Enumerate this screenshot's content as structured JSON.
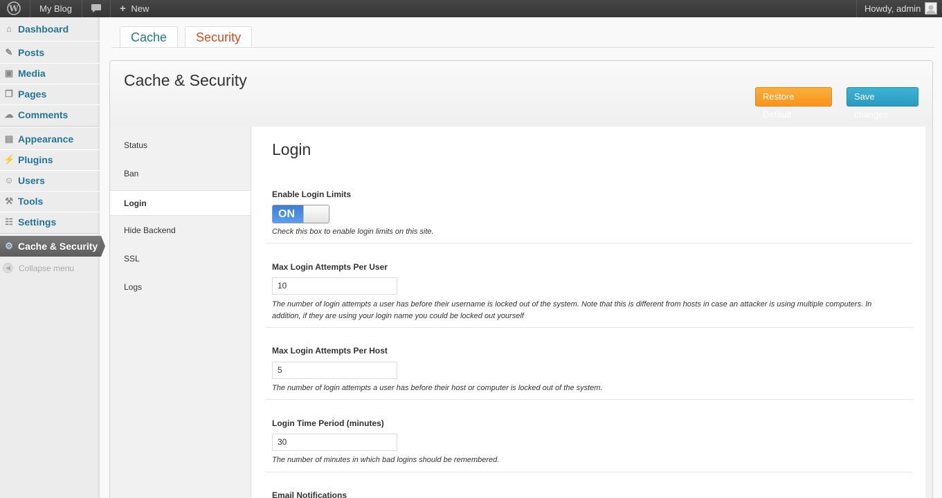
{
  "adminbar": {
    "site_name": "My Blog",
    "new_label": "New",
    "howdy": "Howdy, admin"
  },
  "sidebar": {
    "items": [
      {
        "label": "Dashboard",
        "icon": "dashboard-icon"
      },
      {
        "label": "Posts",
        "icon": "pin-icon"
      },
      {
        "label": "Media",
        "icon": "media-icon"
      },
      {
        "label": "Pages",
        "icon": "pages-icon"
      },
      {
        "label": "Comments",
        "icon": "comment-icon"
      },
      {
        "label": "Appearance",
        "icon": "appearance-icon"
      },
      {
        "label": "Plugins",
        "icon": "plug-icon"
      },
      {
        "label": "Users",
        "icon": "users-icon"
      },
      {
        "label": "Tools",
        "icon": "tools-icon"
      },
      {
        "label": "Settings",
        "icon": "settings-icon"
      },
      {
        "label": "Cache & Security",
        "icon": "gear-icon"
      }
    ],
    "collapse_label": "Collapse menu"
  },
  "tabs": [
    {
      "label": "Cache"
    },
    {
      "label": "Security"
    }
  ],
  "panel": {
    "title": "Cache & Security",
    "restore_label": "Restore Default",
    "save_label": "Save changes"
  },
  "subnav": [
    {
      "label": "Status"
    },
    {
      "label": "Ban"
    },
    {
      "label": "Login"
    },
    {
      "label": "Hide Backend"
    },
    {
      "label": "SSL"
    },
    {
      "label": "Logs"
    }
  ],
  "content": {
    "title": "Login",
    "fields": [
      {
        "label": "Enable Login Limits",
        "toggle_text": "ON",
        "desc": "Check this box to enable login limits on this site."
      },
      {
        "label": "Max Login Attempts Per User",
        "value": "10",
        "desc": "The number of login attempts a user has before their username is locked out of the system. Note that this is different from hosts in case an attacker is using multiple computers. In addition, if they are using your login name you could be locked out yourself"
      },
      {
        "label": "Max Login Attempts Per Host",
        "value": "5",
        "desc": "The number of login attempts a user has before their host or computer is locked out of the system."
      },
      {
        "label": "Login Time Period (minutes)",
        "value": "30",
        "desc": "The number of minutes in which bad logins should be remembered."
      },
      {
        "label": "Email Notifications"
      }
    ]
  },
  "colors": {
    "link_blue": "#21759b",
    "security_tab": "#d54e21",
    "restore_button": "#f7931e",
    "save_button": "#2a9ac0",
    "toggle_on": "#3a7ed8"
  }
}
